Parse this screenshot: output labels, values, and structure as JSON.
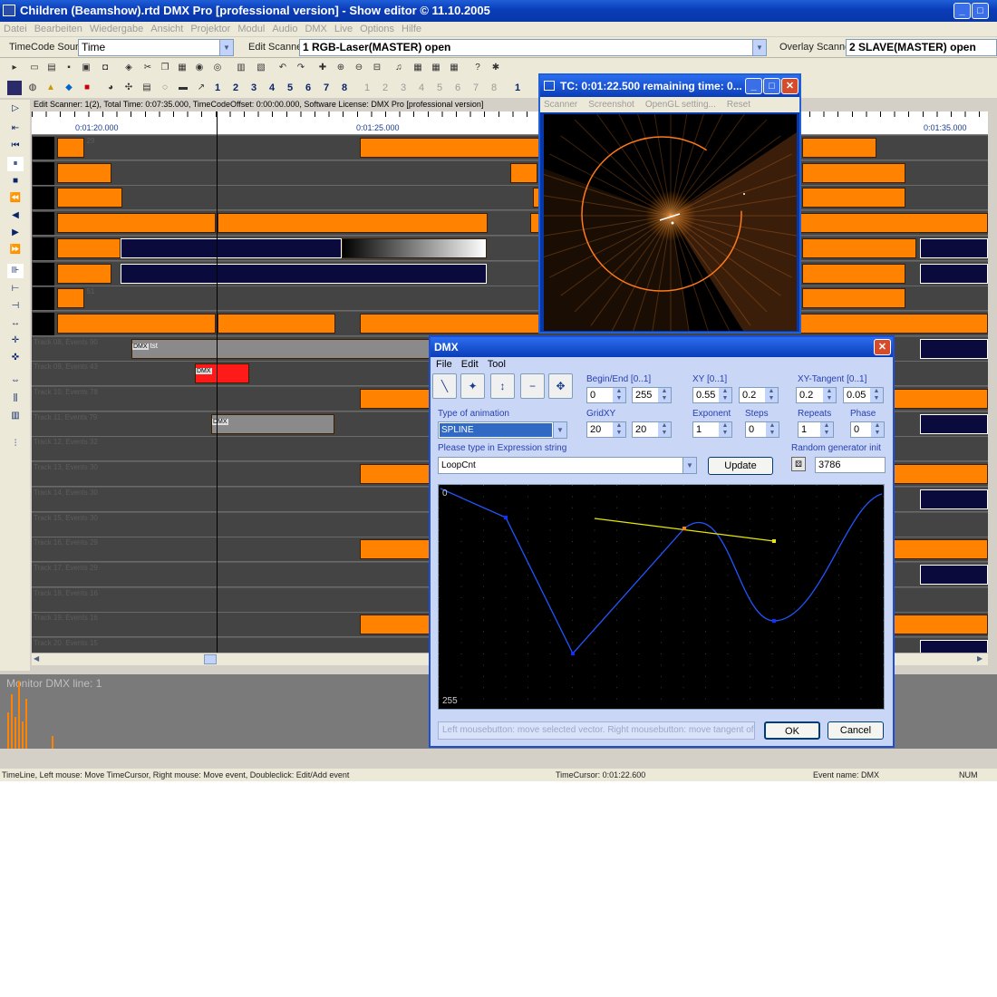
{
  "window": {
    "title": "Children (Beamshow).rtd DMX Pro [professional version] - Show editor © 11.10.2005"
  },
  "menu": [
    "Datei",
    "Bearbeiten",
    "Wiedergabe",
    "Ansicht",
    "Projektor",
    "Modul",
    "Audio",
    "DMX",
    "Live",
    "Options",
    "Hilfe"
  ],
  "sources": {
    "timecode_label": "TimeCode Source",
    "timecode_value": "Time",
    "edit_label": "Edit Scanner",
    "edit_value": "1 RGB-Laser(MASTER) open",
    "overlay_label": "Overlay Scanner",
    "overlay_value": "2 SLAVE(MASTER) open"
  },
  "numbers": [
    "1",
    "2",
    "3",
    "4",
    "5",
    "6",
    "7",
    "8",
    "1",
    "2",
    "3",
    "4",
    "5",
    "6",
    "7",
    "8",
    "1"
  ],
  "editor": {
    "info": "Edit Scanner: 1(2), Total Time: 0:07:35.000, TimeCodeOffset: 0:00:00.000, Software License: DMX Pro [professional version]",
    "ruler": [
      "0:01:20.000",
      "0:01:25.000",
      "0:01:35.000"
    ],
    "tracks": [
      "ts 29",
      "",
      "",
      "",
      "",
      "",
      "ts 51",
      "",
      "Track 08, Events 90",
      "Track 09, Events 43",
      "Track 10, Events 78",
      "Track 11, Events 79",
      "Track 12, Events 32",
      "Track 13, Events 30",
      "Track 14, Events 30",
      "Track 15, Events 30",
      "Track 16, Events 29",
      "Track 17, Events 29",
      "Track 18, Events 16",
      "Track 19, Events 16",
      "Track 20, Events 15"
    ],
    "evlabels": {
      "dmx": "DMX",
      "tst": "tst"
    }
  },
  "monitor": {
    "title": "Monitor DMX line: 1"
  },
  "status": {
    "left": "TimeLine, Left mouse: Move TimeCursor, Right mouse: Move event, Doubleclick: Edit/Add event",
    "cursor": "TimeCursor: 0:01:22.600",
    "event": "Event name: DMX",
    "num": "NUM"
  },
  "tc": {
    "title": "TC: 0:01:22.500 remaining time: 0...",
    "menu": [
      "Scanner",
      "Screenshot",
      "OpenGL setting...",
      "Reset positions"
    ]
  },
  "dmx": {
    "title": "DMX",
    "menu": [
      "File",
      "Edit",
      "Tool"
    ],
    "begin_end": {
      "label": "Begin/End [0..1]",
      "a": "0",
      "b": "255"
    },
    "xy": {
      "label": "XY [0..1]",
      "a": "0.55",
      "b": "0.2"
    },
    "xyt": {
      "label": "XY-Tangent [0..1]",
      "a": "0.2",
      "b": "0.05"
    },
    "anim": {
      "label": "Type of animation",
      "value": "SPLINE"
    },
    "grid": {
      "label": "GridXY",
      "a": "20",
      "b": "20"
    },
    "exponent": {
      "label": "Exponent",
      "value": "1"
    },
    "steps": {
      "label": "Steps",
      "value": "0"
    },
    "repeats": {
      "label": "Repeats",
      "value": "1"
    },
    "phase": {
      "label": "Phase",
      "value": "0"
    },
    "expr": {
      "label": "Please type in Expression string",
      "value": "LoopCnt"
    },
    "update": "Update",
    "random": {
      "label": "Random generator init",
      "value": "3786"
    },
    "graph": {
      "top": "0",
      "bottom": "255"
    },
    "hint": "Left mousebutton: move selected vector. Right mousebutton: move tangent of sele",
    "ok": "OK",
    "cancel": "Cancel"
  },
  "colors": {
    "accent": "#ff8200",
    "title": "#0a3cb8",
    "navy": "#0a0a3c"
  }
}
